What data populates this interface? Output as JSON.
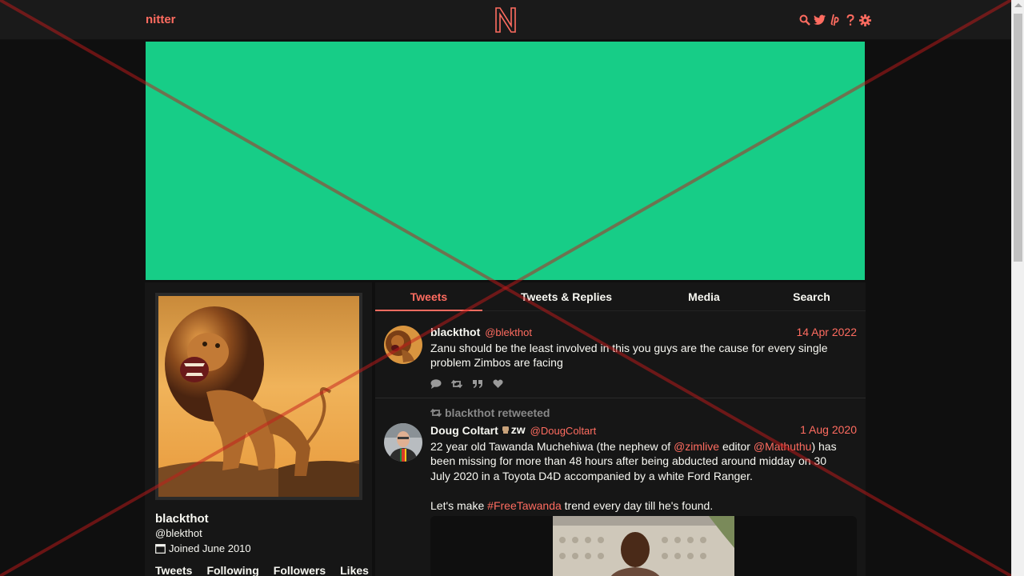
{
  "nav": {
    "brand": "nitter",
    "logo_letter": "N",
    "icons": [
      "search-icon",
      "twitter-icon",
      "liberapay-icon",
      "help-icon",
      "settings-icon"
    ]
  },
  "colors": {
    "accent": "#ff6c60",
    "banner": "#17cd87",
    "background": "#0f0f0f",
    "panel": "#161616"
  },
  "profile": {
    "fullname": "blackthot",
    "username": "@blekthot",
    "joined": "Joined June 2010",
    "stats": [
      "Tweets",
      "Following",
      "Followers",
      "Likes"
    ]
  },
  "tabs": [
    {
      "label": "Tweets",
      "active": true
    },
    {
      "label": "Tweets & Replies",
      "active": false
    },
    {
      "label": "Media",
      "active": false
    },
    {
      "label": "Search",
      "active": false
    }
  ],
  "tweets": [
    {
      "fullname": "blackthot",
      "username": "@blekthot",
      "date": "14 Apr 2022",
      "text": "Zanu should be the least involved in this you guys are the cause for every single problem Zimbos are facing",
      "actions": [
        "comment-icon",
        "retweet-icon",
        "quote-icon",
        "heart-icon"
      ]
    },
    {
      "retweet_label": "blackthot retweeted",
      "fullname": "Doug Coltart",
      "flag_text": "zw",
      "username": "@DougColtart",
      "date": "1 Aug 2020",
      "text_parts": {
        "p1": "22 year old Tawanda Muchehiwa (the nephew of ",
        "mention1": "@zimlive",
        "p2": " editor ",
        "mention2": "@Mathuthu",
        "p3": ") has been missing for more than 48 hours after being abducted around midday on 30 July 2020 in a Toyota D4D accompanied by a white Ford Ranger.",
        "p4": "Let's make ",
        "hashtag": "#FreeTawanda",
        "p5": " trend every day till he's found."
      }
    }
  ]
}
